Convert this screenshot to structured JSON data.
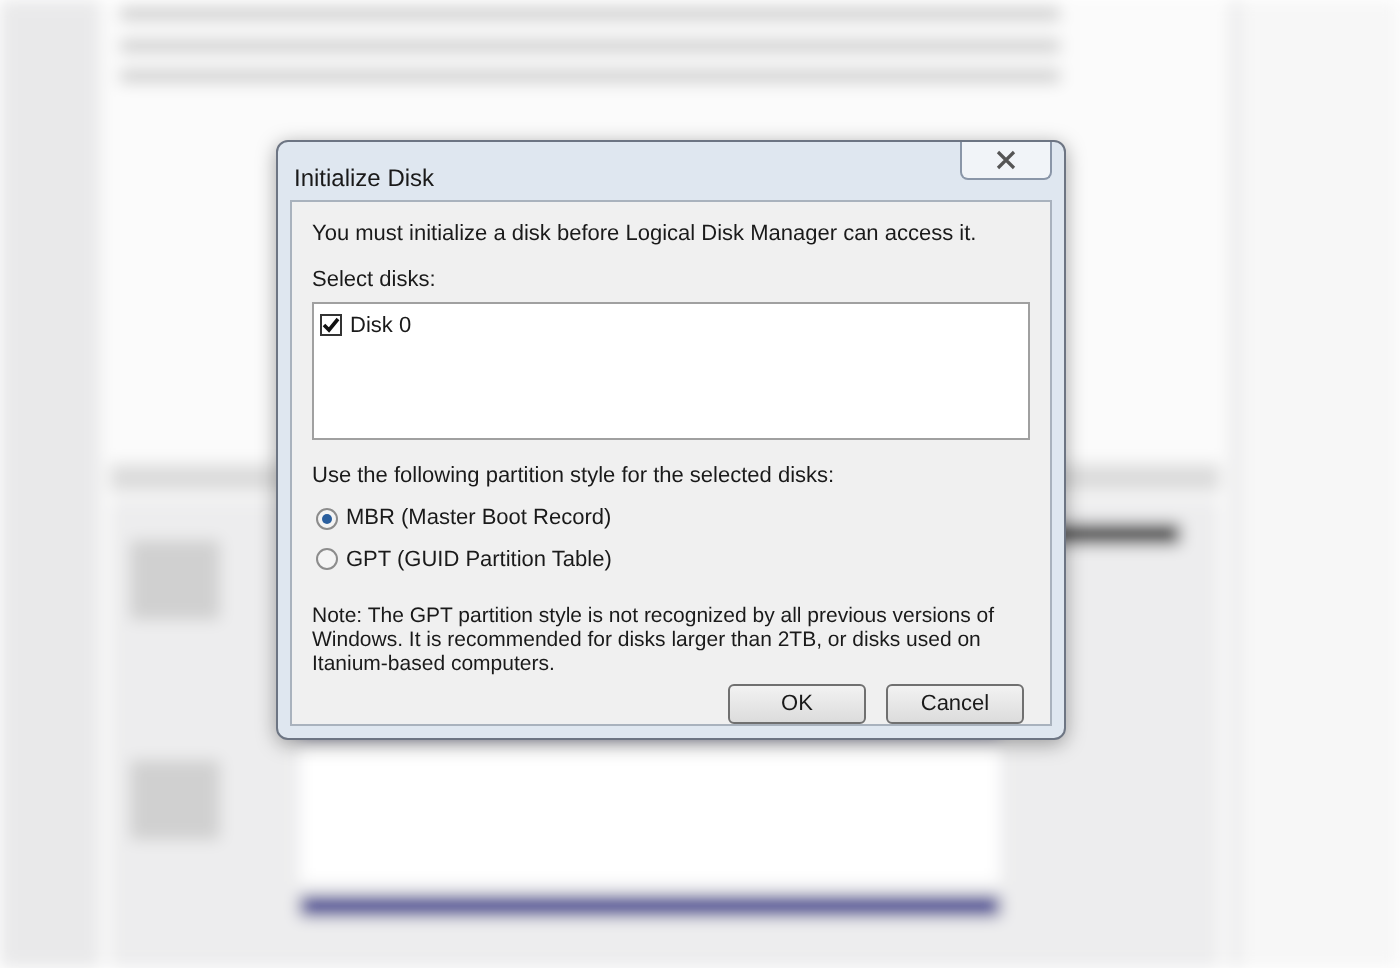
{
  "dialog": {
    "title": "Initialize Disk",
    "intro": "You must initialize a disk before Logical Disk Manager can access it.",
    "disks_label": "Select disks:",
    "disks": [
      {
        "label": "Disk 0",
        "checked": true
      }
    ],
    "style_label": "Use the following partition style for the selected disks:",
    "styles": [
      {
        "label": "MBR (Master Boot Record)",
        "selected": true
      },
      {
        "label": "GPT (GUID Partition Table)",
        "selected": false
      }
    ],
    "note": "Note: The GPT partition style is not recognized by all previous versions of Windows. It is recommended for disks larger than 2TB, or disks used on Itanium-based computers.",
    "buttons": [
      "OK",
      "Cancel"
    ]
  }
}
